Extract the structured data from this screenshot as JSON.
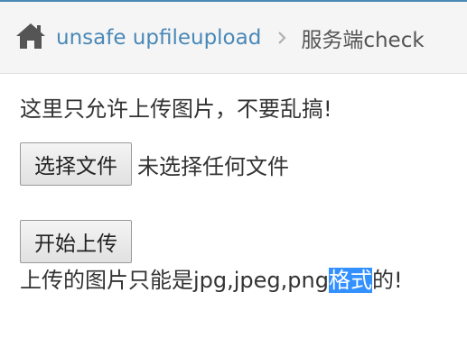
{
  "breadcrumb": {
    "home_icon": "home-icon",
    "link_label": "unsafe upfileupload",
    "separator_icon": "chevron-right-icon",
    "current_label": "服务端check"
  },
  "notice": "这里只允许上传图片，不要乱搞!",
  "file_input": {
    "button_label": "选择文件",
    "status_text": "未选择任何文件"
  },
  "upload_button_label": "开始上传",
  "hint": {
    "before": "上传的图片只能是jpg,jpeg,png",
    "selected": "格式",
    "after": "的!"
  },
  "colors": {
    "accent": "#4a88b7",
    "selection": "#3390ff",
    "breadcrumb_bg": "#f5f5f5"
  }
}
